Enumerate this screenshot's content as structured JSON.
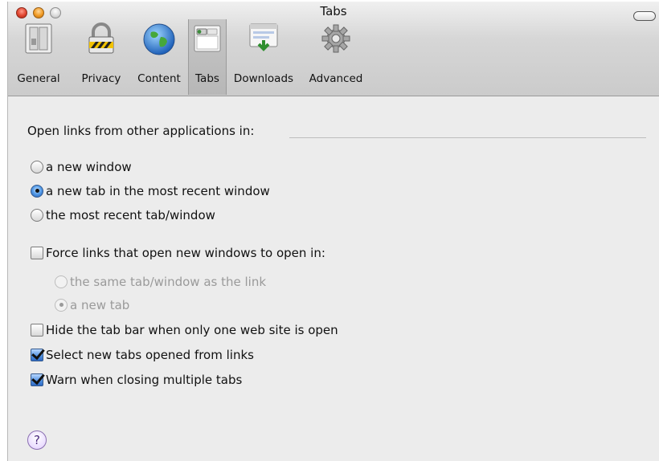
{
  "window": {
    "title": "Tabs"
  },
  "toolbar": {
    "items": [
      {
        "label": "General",
        "icon": "general-switch-icon"
      },
      {
        "label": "Privacy",
        "icon": "padlock-icon"
      },
      {
        "label": "Content",
        "icon": "globe-icon"
      },
      {
        "label": "Tabs",
        "icon": "tabs-icon",
        "selected": true
      },
      {
        "label": "Downloads",
        "icon": "download-icon"
      },
      {
        "label": "Advanced",
        "icon": "gear-icon"
      }
    ]
  },
  "links_section": {
    "heading": "Open links from other applications in:",
    "options": [
      {
        "label": "a new window",
        "selected": false
      },
      {
        "label": "a new tab in the most recent window",
        "selected": true
      },
      {
        "label": "the most recent tab/window",
        "selected": false
      }
    ]
  },
  "force_links": {
    "label": "Force links that open new windows to open in:",
    "checked": false,
    "sub_options": [
      {
        "label": "the same tab/window as the link",
        "selected": false,
        "enabled": false
      },
      {
        "label": "a new tab",
        "selected": true,
        "enabled": false
      }
    ]
  },
  "checkboxes": [
    {
      "label": "Hide the tab bar when only one web site is open",
      "checked": false
    },
    {
      "label": "Select new tabs opened from links",
      "checked": true
    },
    {
      "label": "Warn when closing multiple tabs",
      "checked": true
    }
  ],
  "help": {
    "label": "?"
  },
  "colors": {
    "accent": "#2e69c4",
    "help_ring": "#8a6fb0"
  }
}
